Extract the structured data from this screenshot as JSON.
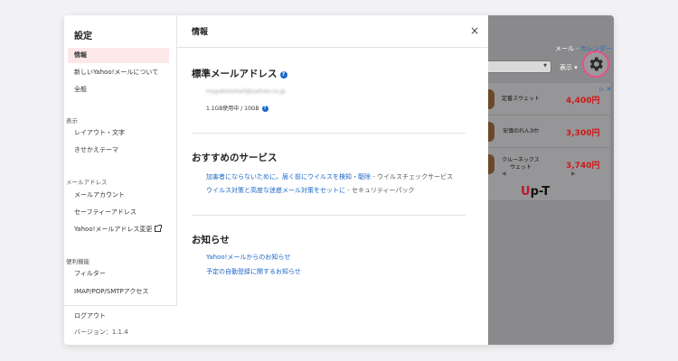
{
  "sidebar": {
    "title": "設定",
    "items": [
      {
        "label": "情報"
      },
      {
        "label": "新しいYahoo!メールについて"
      },
      {
        "label": "全般"
      }
    ],
    "section_display": "表示",
    "display_items": [
      {
        "label": "レイアウト・文字"
      },
      {
        "label": "きせかえテーマ"
      }
    ],
    "section_address": "メールアドレス",
    "address_items": [
      {
        "label": "メールアカウント"
      },
      {
        "label": "セーフティーアドレス"
      },
      {
        "label": "Yahoo!メールアドレス変更"
      }
    ],
    "section_convenience": "便利機能",
    "convenience_items": [
      {
        "label": "フィルター"
      },
      {
        "label": "IMAP/POP/SMTPアクセス"
      }
    ],
    "logout": "ログアウト",
    "version": "バージョン：1.1.4"
  },
  "main": {
    "title": "情報",
    "close": "×",
    "std_address_heading": "標準メールアドレス",
    "email": "myyahoomail@yahoo.co.jp",
    "usage": "1.1GB使用中 / 10GB",
    "services_heading": "おすすめのサービス",
    "service1_link": "加害者にならないために。届く前にウイルスを検知・駆除",
    "service1_suffix": " - ウイルスチェックサービス",
    "service2_link": "ウイルス対策と高度な迷惑メール対策をセットに",
    "service2_suffix": " - セキュリティーパック",
    "news_heading": "お知らせ",
    "news1": "Yahoo!メールからのお知らせ",
    "news2": "予定の自動登録に関するお知らせ"
  },
  "background": {
    "header_left": "メール",
    "header_sep": " - ",
    "header_right": "カレンダー",
    "display_label": "表示 ▾",
    "ad_badge": "▷ ✕",
    "ad_items": [
      {
        "name": "定番スウェット",
        "price": "4,400円"
      },
      {
        "name": "安価のれん3巾",
        "price": "3,300円"
      },
      {
        "name": "クルーネックス\nウェット",
        "price": "3,740円"
      }
    ],
    "ad_prev": "◀",
    "ad_next": "▶",
    "ad_logo_u": "U",
    "ad_logo_rest": "p-T"
  }
}
